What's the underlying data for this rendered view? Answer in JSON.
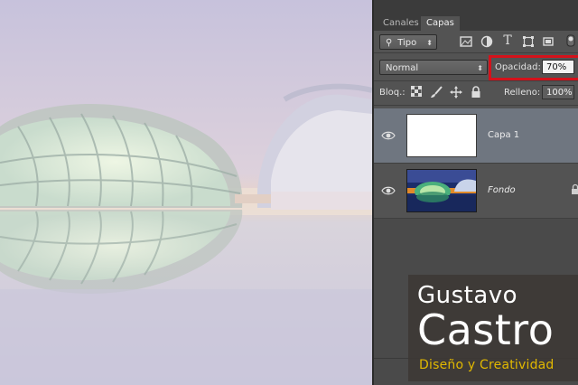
{
  "tabs": [
    {
      "label": "Canales",
      "active": false
    },
    {
      "label": "Capas",
      "active": true
    }
  ],
  "filter": {
    "kind_label": "Tipo",
    "icons": [
      "image-filter-icon",
      "adjustment-filter-icon",
      "type-filter-icon",
      "shape-filter-icon",
      "smart-object-filter-icon"
    ]
  },
  "blend": {
    "mode": "Normal",
    "opacity_label": "Opacidad:",
    "opacity_value": "70%"
  },
  "lock": {
    "label": "Bloq.:",
    "fill_label": "Relleno:",
    "fill_value": "100%",
    "icons": [
      "lock-transparency-icon",
      "lock-brush-icon",
      "lock-move-icon",
      "lock-all-icon"
    ]
  },
  "layers": [
    {
      "name": "Capa 1",
      "selected": true,
      "visible": true
    },
    {
      "name": "Fondo",
      "selected": false,
      "visible": true,
      "italic": true,
      "locked": true
    }
  ],
  "logo": {
    "line1": "Gustavo",
    "line2": "Castro",
    "tagline": "Diseño y Creatividad"
  },
  "colors": {
    "panel": "#535353",
    "highlight": "#d4121b",
    "tagline": "#e1b800",
    "selected_layer": "#6f7680"
  }
}
